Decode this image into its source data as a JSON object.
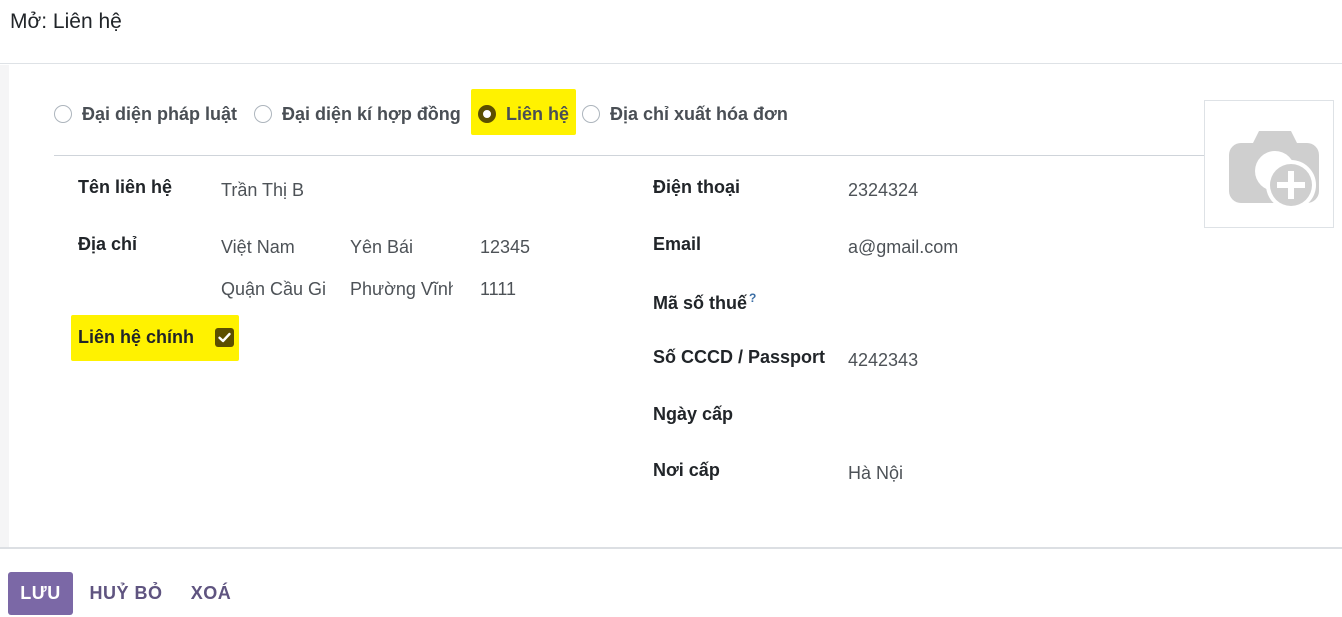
{
  "header": {
    "title": "Mở: Liên hệ"
  },
  "contact_type": {
    "options": [
      {
        "label": "Đại diện pháp luật",
        "checked": false
      },
      {
        "label": "Đại diện kí hợp đồng",
        "checked": false
      },
      {
        "label": "Liên hệ",
        "checked": true
      },
      {
        "label": "Địa chỉ xuất hóa đơn",
        "checked": false
      }
    ]
  },
  "left_form": {
    "contact_name": {
      "label": "Tên liên hệ",
      "value": "Trần Thị B"
    },
    "address": {
      "label": "Địa chỉ",
      "country": "Việt Nam",
      "province": "Yên Bái",
      "zip": "12345",
      "district": "Quận Cầu Giấy",
      "ward": "Phường Vĩnh Phúc",
      "street": "1111"
    },
    "primary_contact": {
      "label": "Liên hệ chính",
      "checked": true
    }
  },
  "right_form": {
    "phone": {
      "label": "Điện thoại",
      "value": "2324324"
    },
    "email": {
      "label": "Email",
      "value": "a@gmail.com"
    },
    "tax_code": {
      "label": "Mã số thuế",
      "help": "?",
      "value": ""
    },
    "id_number": {
      "label": "Số CCCD / Passport",
      "value": "4242343"
    },
    "issue_date": {
      "label": "Ngày cấp",
      "value": ""
    },
    "issue_place": {
      "label": "Nơi cấp",
      "value": "Hà Nội"
    }
  },
  "avatar": {
    "icon": "camera-plus-icon"
  },
  "footer": {
    "save_label": "LƯU",
    "cancel_label": "HUỶ BỎ",
    "delete_label": "XOÁ"
  },
  "colors": {
    "primary": "#7b68a6",
    "highlight": "#fff200",
    "checked": "#5c4f00"
  }
}
